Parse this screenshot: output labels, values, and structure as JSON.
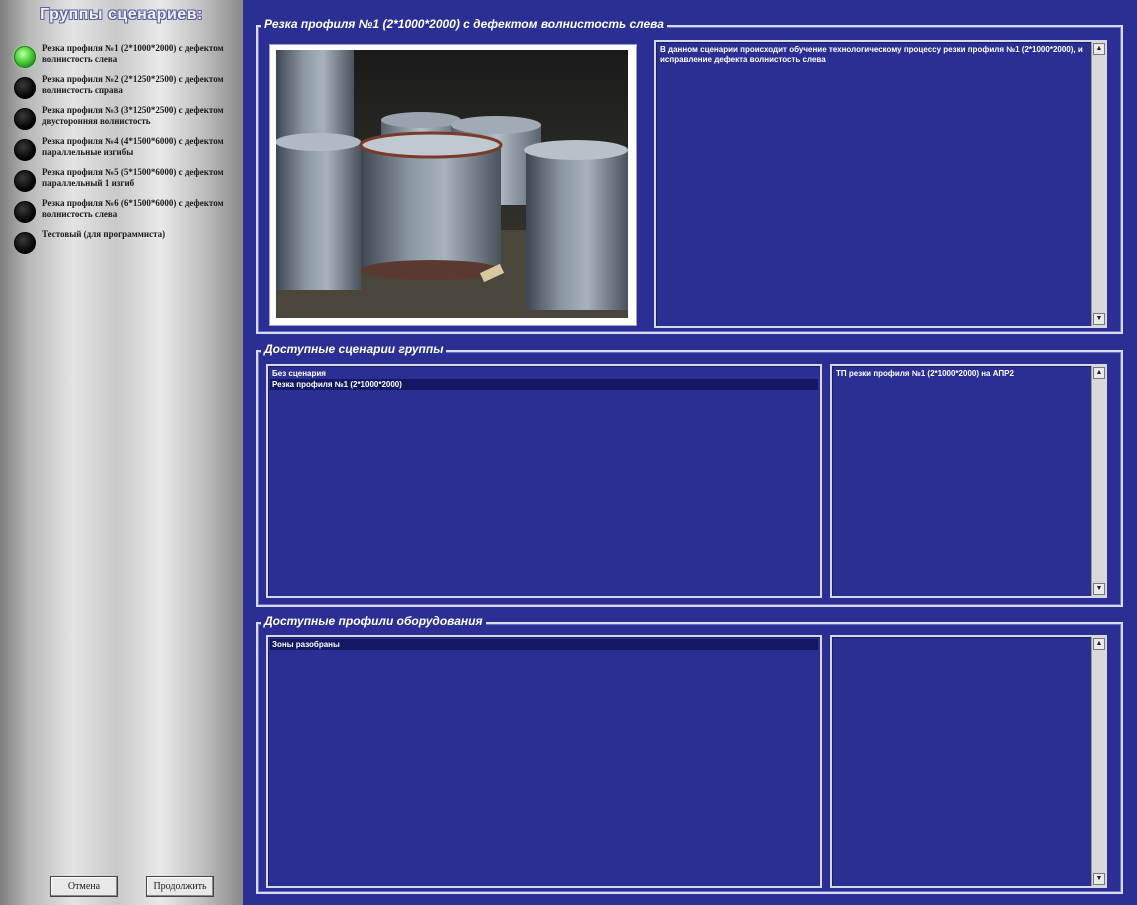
{
  "sidebar": {
    "title": "Группы сценариев:",
    "groups": [
      {
        "label": "Резка профиля №1 (2*1000*2000) с дефектом волнистость слева",
        "active": true
      },
      {
        "label": "Резка профиля №2 (2*1250*2500) с дефектом волнистость справа",
        "active": false
      },
      {
        "label": "Резка профиля №3 (3*1250*2500) с дефектом двусторонняя волнистость",
        "active": false
      },
      {
        "label": "Резка профиля №4 (4*1500*6000) с дефектом параллельные изгибы",
        "active": false
      },
      {
        "label": "Резка профиля №5 (5*1500*6000) с дефектом параллельный 1 изгиб",
        "active": false
      },
      {
        "label": "Резка профиля №6 (6*1500*6000) с дефектом волнистость слева",
        "active": false
      },
      {
        "label": "Тестовый (для программиста)",
        "active": false
      }
    ],
    "cancel_label": "Отмена",
    "continue_label": "Продолжить"
  },
  "scenario_panel": {
    "title": "Резка профиля №1 (2*1000*2000) с дефектом волнистость слева",
    "description": "В данном сценарии происходит обучение технологическому процессу резки профиля №1 (2*1000*2000), и исправление дефекта волнистость слева"
  },
  "scenarios_panel": {
    "title": "Доступные сценарии группы",
    "items": [
      "Без сценария",
      "Резка профиля №1 (2*1000*2000)"
    ],
    "selected_index": 1,
    "info": "ТП резки профиля №1 (2*1000*2000) на АПР2"
  },
  "equipment_panel": {
    "title": "Доступные профили оборудования",
    "items": [
      "Зоны разобраны"
    ],
    "selected_index": 0,
    "info": ""
  },
  "colors": {
    "background": "#2b2f94",
    "active_indicator": "#5fe04a",
    "inactive_indicator": "#050505",
    "selection": "#141763"
  }
}
